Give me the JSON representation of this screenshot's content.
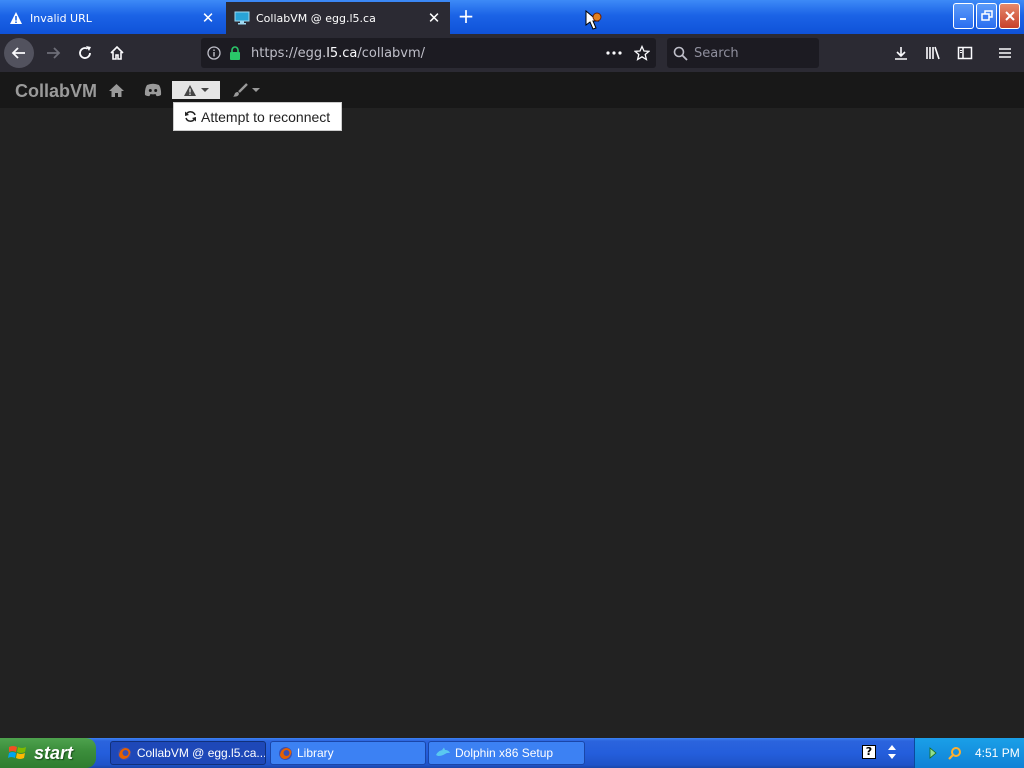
{
  "browser": {
    "tabs": [
      {
        "label": "Invalid URL",
        "icon": "warning-icon"
      },
      {
        "label": "CollabVM @ egg.l5.ca",
        "icon": "monitor-icon"
      }
    ],
    "url": {
      "prefix": "https://egg.",
      "host": "l5.ca",
      "path": "/collabvm/"
    },
    "search": {
      "placeholder": "Search"
    },
    "colors": {
      "chrome": "#2b2a33",
      "titlebar": "#1b63e6"
    }
  },
  "collabvm": {
    "brand": "CollabVM",
    "dropdown": {
      "reconnect_label": "Attempt to reconnect"
    },
    "colors": {
      "bar": "#181818",
      "background": "#222222"
    }
  },
  "taskbar": {
    "start_label": "start",
    "tasks": [
      {
        "label": "CollabVM @ egg.l5.ca...",
        "icon": "firefox-icon"
      },
      {
        "label": "Library",
        "icon": "firefox-icon"
      },
      {
        "label": "Dolphin x86 Setup",
        "icon": "dolphin-icon"
      }
    ],
    "clock": "4:51 PM"
  }
}
